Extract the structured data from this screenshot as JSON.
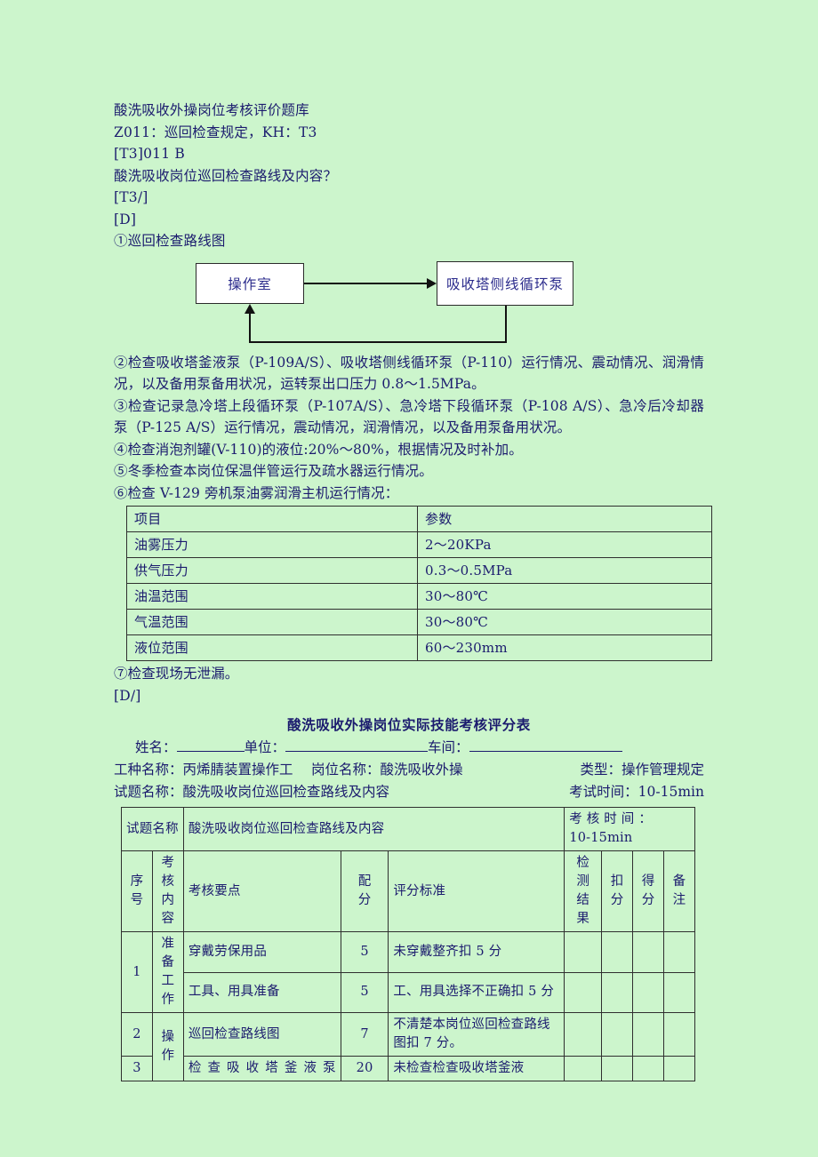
{
  "document": {
    "heading": "酸洗吸收外操岗位考核评价题库",
    "code_line": "Z011：巡回检查规定，KH：T3",
    "tag_line": "[T3]011  B",
    "question": "酸洗吸收岗位巡回检查路线及内容？",
    "tag_close": "[T3/]",
    "answer_open": "[D]",
    "item1": "①巡回检查路线图",
    "answer_close": "[D/]"
  },
  "diagram": {
    "box_a": "操作室",
    "box_b": "吸收塔侧线循环泵"
  },
  "items": {
    "item2": "②检查吸收塔釜液泵（P-109A/S）、吸收塔侧线循环泵（P-110）运行情况、震动情况、润滑情况，以及备用泵备用状况，运转泵出口压力 0.8～1.5MPa。",
    "item3": "③检查记录急冷塔上段循环泵（P-107A/S）、急冷塔下段循环泵（P-108 A/S）、急冷后冷却器泵（P-125 A/S）运行情况，震动情况，润滑情况，以及备用泵备用状况。",
    "item4": "④检查消泡剂罐(V-110)的液位:20%～80%，根据情况及时补加。",
    "item5": "⑤冬季检查本岗位保温伴管运行及疏水器运行情况。",
    "item6": "⑥检查 V-129 旁机泵油雾润滑主机运行情况：",
    "item7": "⑦检查现场无泄漏。"
  },
  "param_table": {
    "headers": [
      "项目",
      "参数"
    ],
    "rows": [
      [
        "油雾压力",
        "2～20KPa"
      ],
      [
        "供气压力",
        "0.3～0.5MPa"
      ],
      [
        "油温范围",
        "30～80℃"
      ],
      [
        "气温范围",
        "30～80℃"
      ],
      [
        "液位范围",
        "60～230mm"
      ]
    ]
  },
  "score_sheet": {
    "title": "酸洗吸收外操岗位实际技能考核评分表",
    "blank_labels": {
      "name": "姓名：",
      "unit": "单位：",
      "workshop": "车间："
    },
    "info_line1": {
      "job_label": "工种名称：",
      "job_value": "丙烯腈装置操作工",
      "post_label": "岗位名称：",
      "post_value": "酸洗吸收外操",
      "type_label": "类型：",
      "type_value": "操作管理规定"
    },
    "info_line2": {
      "subject_label": "试题名称：",
      "subject_value": "酸洗吸收岗位巡回检查路线及内容",
      "time_label": "考试时间：",
      "time_value": "10-15min"
    },
    "table_head": {
      "subject_label": "试题名称",
      "subject_value": "酸洗吸收岗位巡回检查路线及内容",
      "exam_time_label": "考 核 时 间 ：",
      "exam_time_value": "10-15min"
    },
    "columns": {
      "seq": "序号",
      "category": "考核内容",
      "point": "考核要点",
      "score": "配分",
      "standard": "评分标准",
      "result": "检测结果",
      "deduct": "扣分",
      "gain": "得分",
      "note": "备注"
    },
    "rows": [
      {
        "seq": "1",
        "category": "准备工作",
        "sub_rows": [
          {
            "point": "穿戴劳保用品",
            "score": "5",
            "standard": "未穿戴整齐扣 5 分",
            "result": "",
            "deduct": "",
            "gain": "",
            "note": ""
          },
          {
            "point": "工具、用具准备",
            "score": "5",
            "standard": "工、用具选择不正确扣 5 分",
            "result": "",
            "deduct": "",
            "gain": "",
            "note": ""
          }
        ]
      },
      {
        "seq": "2",
        "category": "操作",
        "sub_rows": [
          {
            "point": "巡回检查路线图",
            "score": "7",
            "standard": "不清楚本岗位巡回检查路线图扣 7 分。",
            "result": "",
            "deduct": "",
            "gain": "",
            "note": ""
          }
        ]
      },
      {
        "seq": "3",
        "category": "",
        "sub_rows": [
          {
            "point": "检查吸收塔釜液泵",
            "score": "20",
            "standard": "未检查检查吸收塔釜液",
            "result": "",
            "deduct": "",
            "gain": "",
            "note": ""
          }
        ]
      }
    ]
  },
  "colors": {
    "page_background": "#ccf5cc",
    "text": "#1b1b6e",
    "box_fill": "#ffffff",
    "border": "#2f2f2f"
  }
}
